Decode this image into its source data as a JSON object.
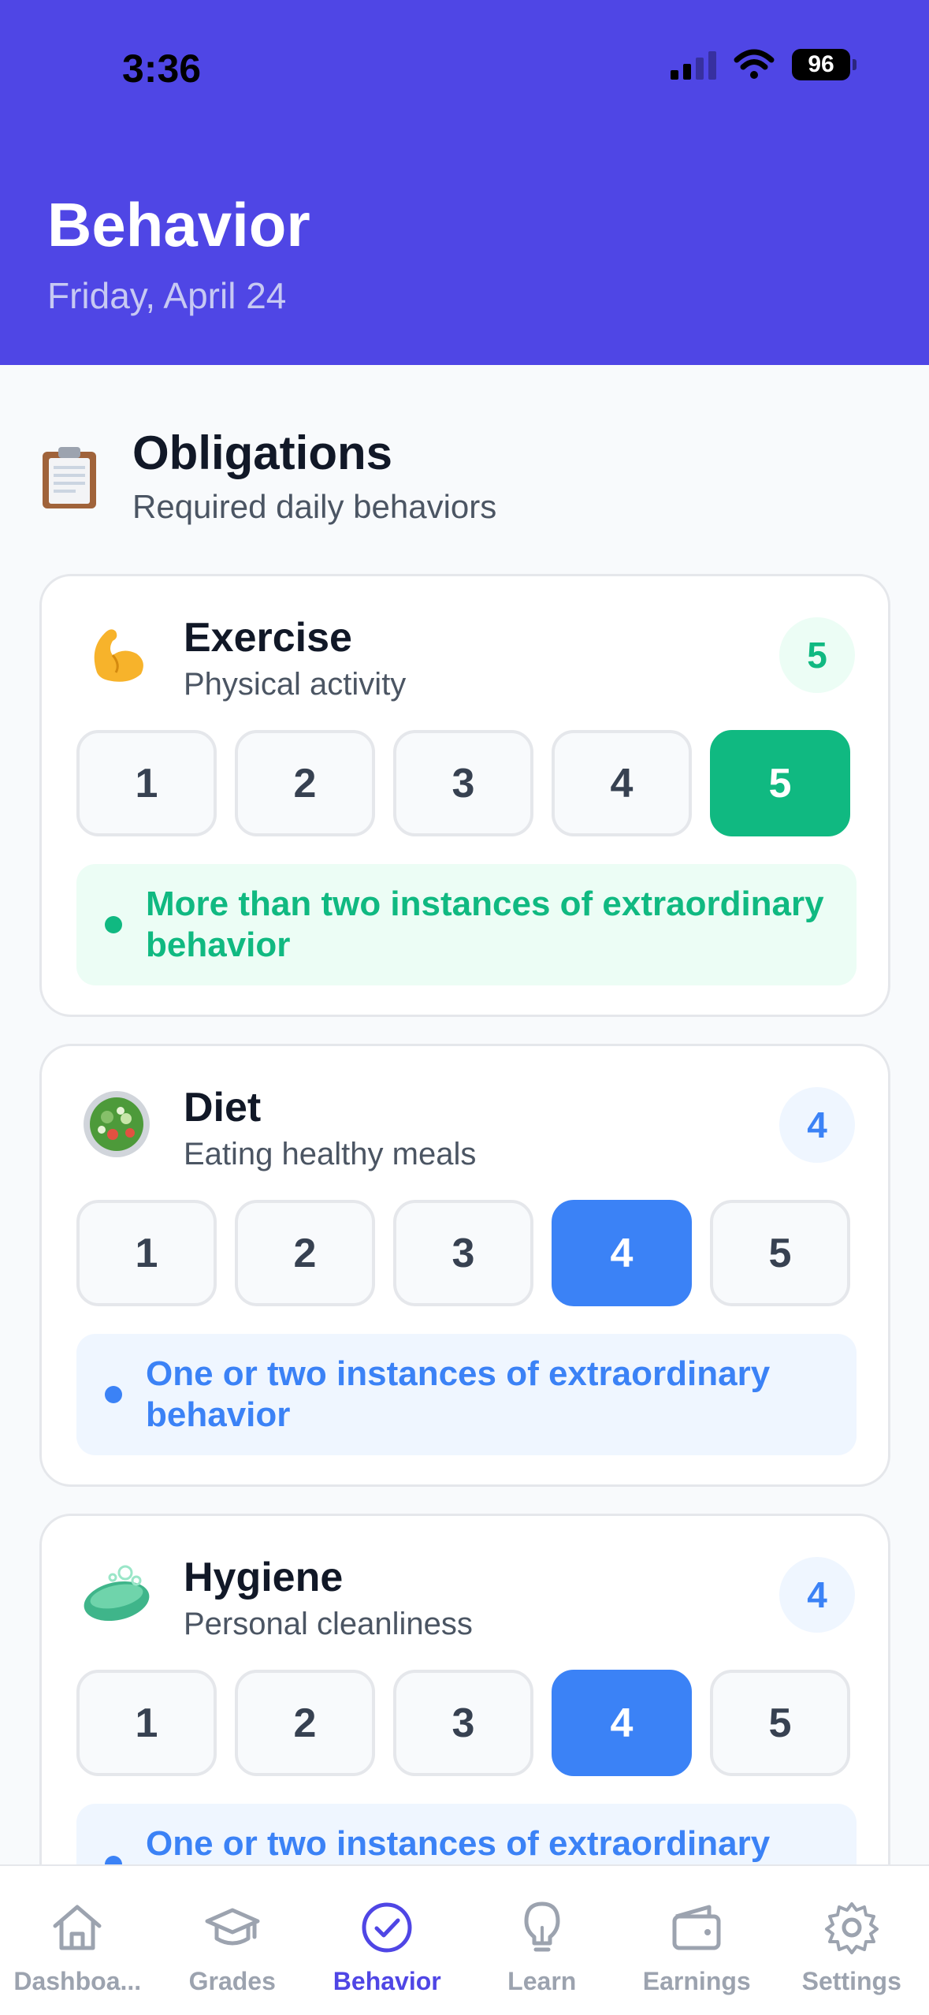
{
  "status_bar": {
    "time": "3:36",
    "battery": "96"
  },
  "header": {
    "title": "Behavior",
    "date": "Friday, April 24"
  },
  "section": {
    "icon": "clipboard-icon",
    "title": "Obligations",
    "subtitle": "Required daily behaviors"
  },
  "cards": [
    {
      "icon": "flexed-biceps-icon",
      "title": "Exercise",
      "subtitle": "Physical activity",
      "score": "5",
      "options": [
        "1",
        "2",
        "3",
        "4",
        "5"
      ],
      "selected": 5,
      "description": "More than two instances of extraordinary behavior",
      "accent": "#10b981",
      "tint": "#ecfdf5"
    },
    {
      "icon": "salad-icon",
      "title": "Diet",
      "subtitle": "Eating healthy meals",
      "score": "4",
      "options": [
        "1",
        "2",
        "3",
        "4",
        "5"
      ],
      "selected": 4,
      "description": "One or two instances of extraordinary behavior",
      "accent": "#3b82f6",
      "tint": "#eff6ff"
    },
    {
      "icon": "soap-icon",
      "title": "Hygiene",
      "subtitle": "Personal cleanliness",
      "score": "4",
      "options": [
        "1",
        "2",
        "3",
        "4",
        "5"
      ],
      "selected": 4,
      "description": "One or two instances of extraordinary behavior",
      "accent": "#3b82f6",
      "tint": "#eff6ff"
    }
  ],
  "tabs": [
    {
      "label": "Dashboa...",
      "icon": "house-icon",
      "active": false
    },
    {
      "label": "Grades",
      "icon": "graduation-cap-icon",
      "active": false
    },
    {
      "label": "Behavior",
      "icon": "check-circle-icon",
      "active": true
    },
    {
      "label": "Learn",
      "icon": "lightbulb-icon",
      "active": false
    },
    {
      "label": "Earnings",
      "icon": "wallet-icon",
      "active": false
    },
    {
      "label": "Settings",
      "icon": "gear-icon",
      "active": false
    }
  ],
  "colors": {
    "brand": "#4f46e5",
    "green": "#10b981",
    "blue": "#3b82f6"
  }
}
